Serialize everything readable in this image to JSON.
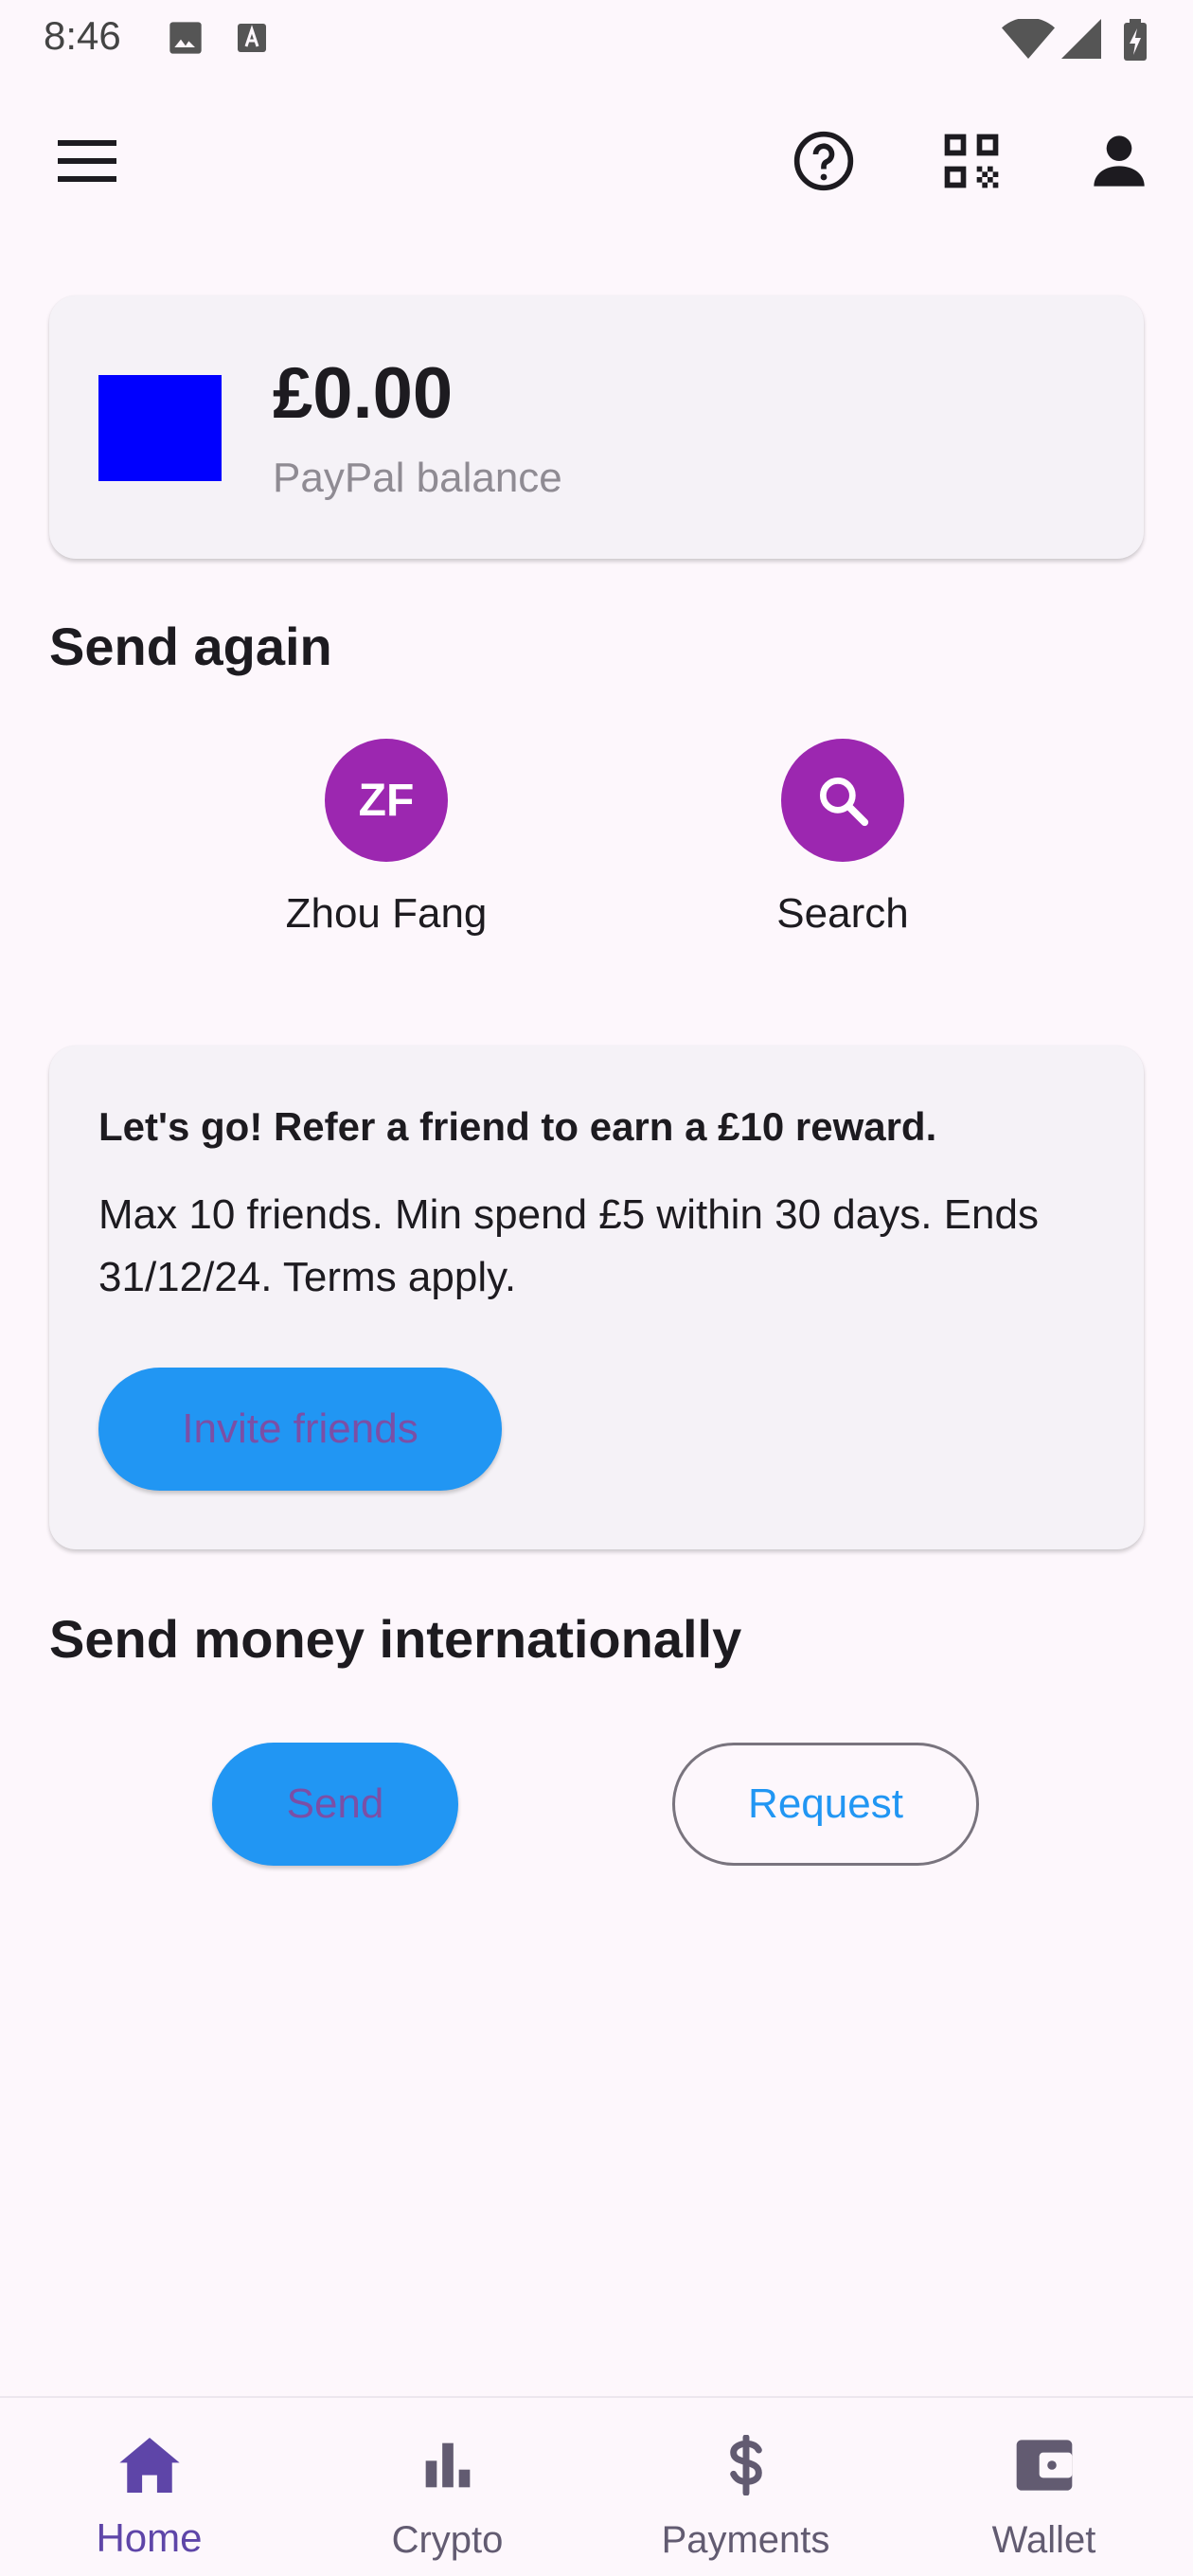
{
  "status_bar": {
    "time": "8:46",
    "icons": [
      "image-icon",
      "text-a-icon",
      "wifi-icon",
      "signal-icon",
      "battery-icon"
    ]
  },
  "top_bar": {
    "icons": [
      "menu-icon",
      "help-icon",
      "qr-code-icon",
      "account-icon"
    ]
  },
  "balance": {
    "amount": "£0.00",
    "label": "PayPal balance",
    "logo_color": "#0000ff"
  },
  "send_again": {
    "title": "Send again",
    "contacts": [
      {
        "initials": "ZF",
        "name": "Zhou Fang"
      },
      {
        "icon": "search-icon",
        "name": "Search"
      }
    ]
  },
  "referral": {
    "title": "Let's go! Refer a friend to earn a £10 reward.",
    "body": "Max 10 friends. Min spend £5 within 30 days. Ends 31/12/24. Terms apply.",
    "button_label": "Invite friends"
  },
  "international": {
    "title": "Send money internationally",
    "send_label": "Send",
    "request_label": "Request"
  },
  "bottom_nav": {
    "items": [
      {
        "label": "Home",
        "icon": "home-icon",
        "active": true
      },
      {
        "label": "Crypto",
        "icon": "bar-chart-icon",
        "active": false
      },
      {
        "label": "Payments",
        "icon": "dollar-icon",
        "active": false
      },
      {
        "label": "Wallet",
        "icon": "wallet-icon",
        "active": false
      }
    ]
  },
  "colors": {
    "accent_purple": "#9c27b0",
    "button_blue": "#2196f3",
    "nav_active": "#5e45a8",
    "background": "#fdf7fc"
  }
}
